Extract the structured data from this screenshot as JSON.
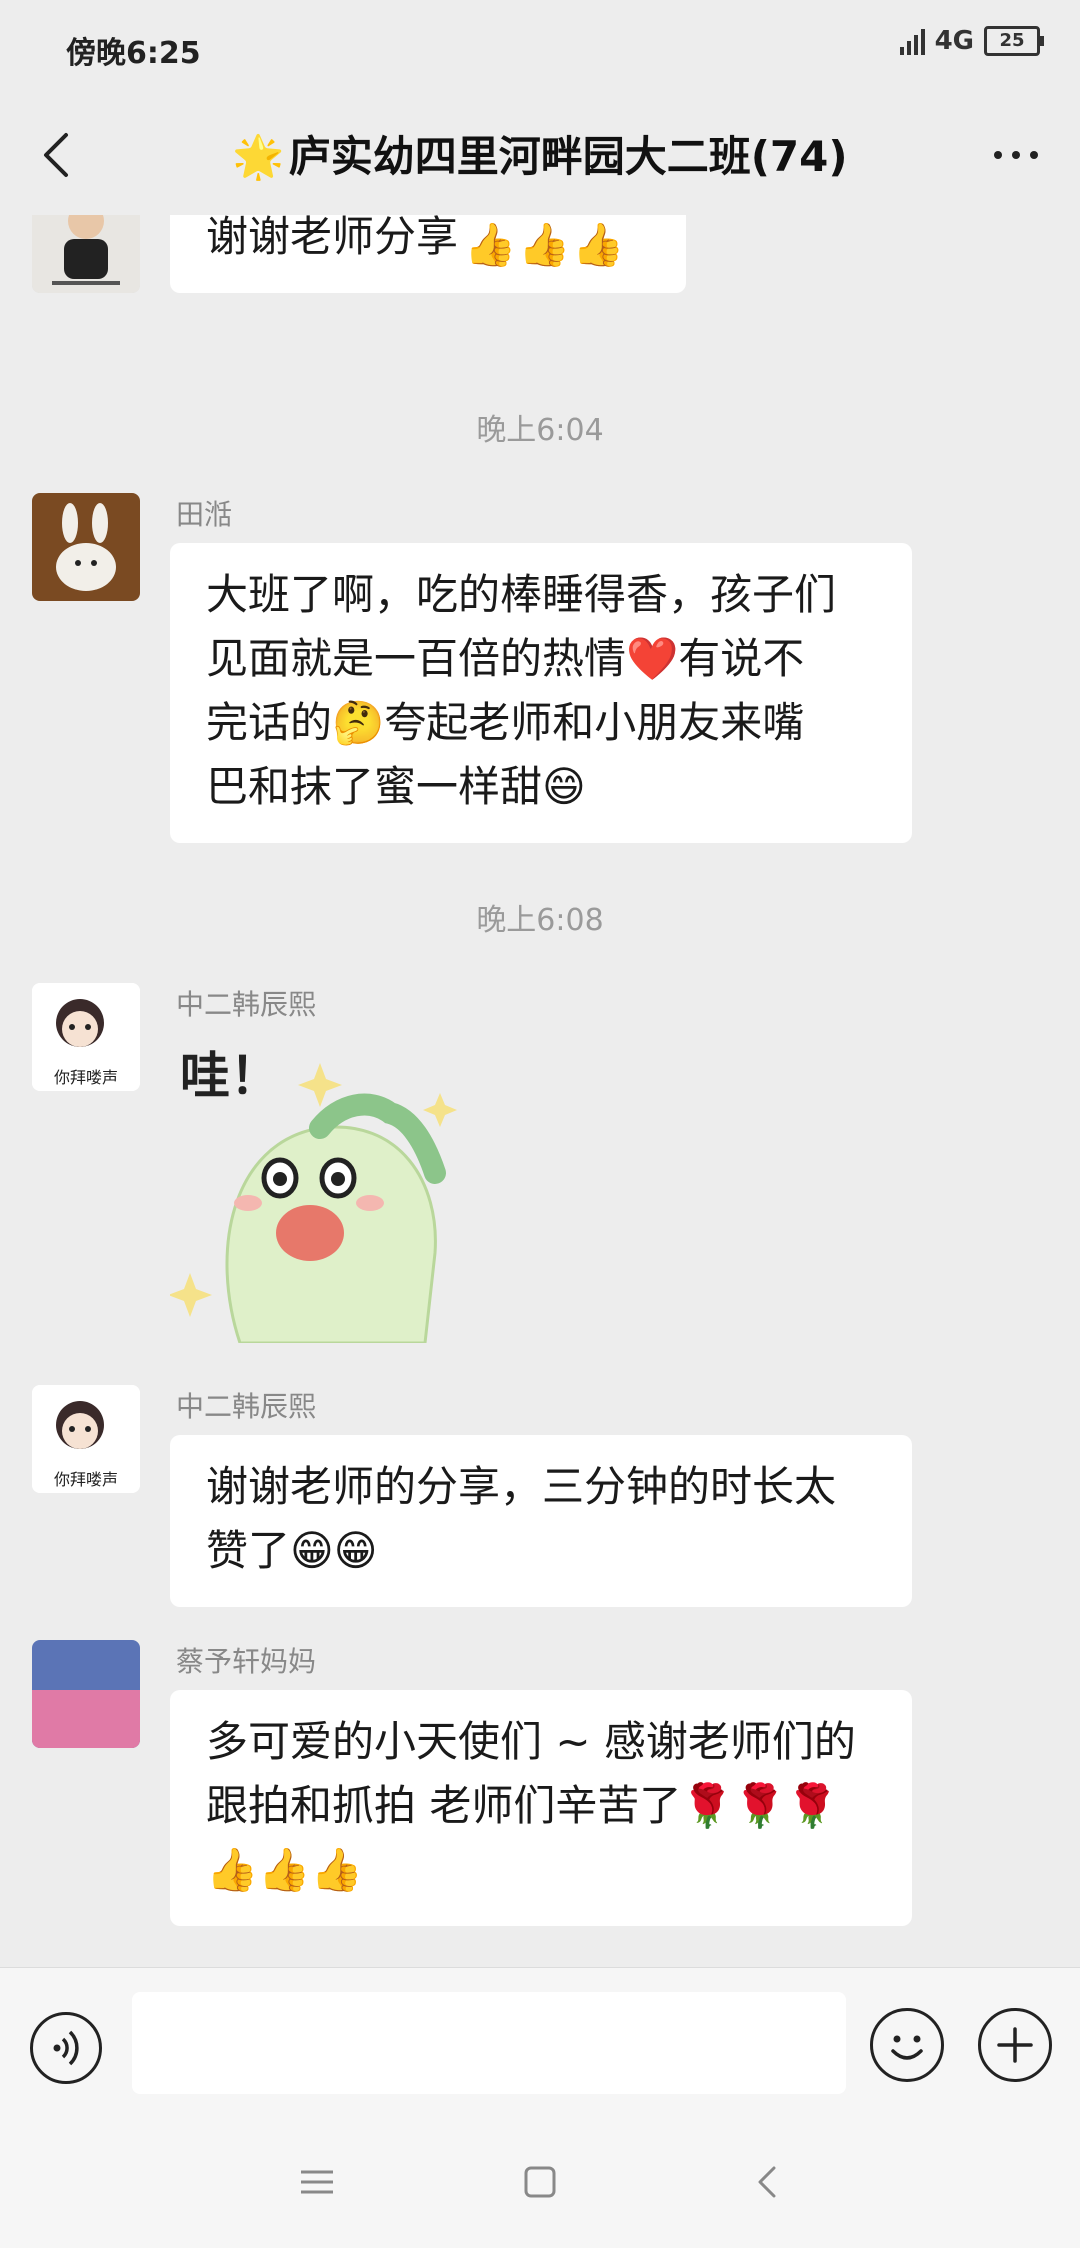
{
  "status": {
    "time": "傍晚6:25",
    "network": "4G",
    "battery": "25"
  },
  "header": {
    "title": "庐实幼四里河畔园大二班(74)"
  },
  "messages": [
    {
      "sender": "",
      "text": "谢谢老师分享"
    },
    {
      "timestamp": "晚上6:04"
    },
    {
      "sender": "田湉",
      "lines": [
        "大班了啊，吃的棒睡得香，孩子们",
        "见面就是一百倍的热情❤️有说不",
        "完话的🤔夸起老师和小朋友来嘴",
        "巴和抹了蜜一样甜😄"
      ]
    },
    {
      "timestamp": "晚上6:08"
    },
    {
      "sender": "中二韩辰熙",
      "sticker_text": "哇！"
    },
    {
      "sender": "中二韩辰熙",
      "lines": [
        "谢谢老师的分享，三分钟的时长太",
        "赞了😁😁"
      ]
    },
    {
      "sender": "蔡予轩妈妈",
      "lines": [
        "多可爱的小天使们 ~ 感谢老师们的",
        "跟拍和抓拍 老师们辛苦了🌹🌹🌹",
        "👍👍👍"
      ]
    }
  ],
  "avatar_text": {
    "han": "你拜喽声"
  },
  "colors": {
    "background": "#ededed",
    "bubble": "#ffffff",
    "accent_star": "#f4c32a"
  }
}
